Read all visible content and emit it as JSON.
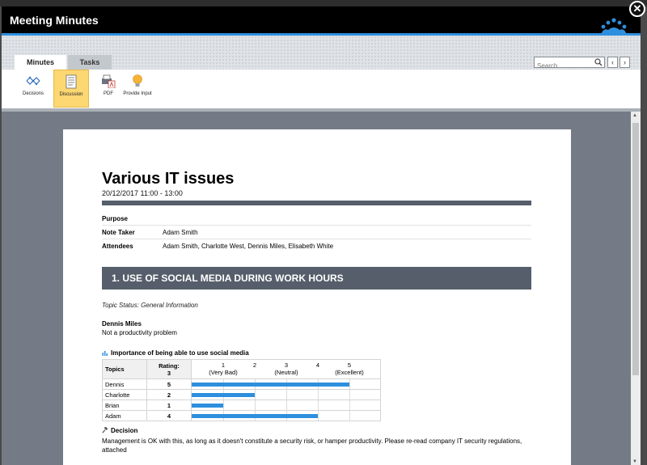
{
  "window": {
    "title": "Meeting Minutes"
  },
  "tabs": [
    {
      "label": "Minutes",
      "active": true
    },
    {
      "label": "Tasks",
      "active": false
    }
  ],
  "search": {
    "placeholder": "Search"
  },
  "nav": {
    "prev": "‹",
    "next": "›"
  },
  "ribbon": [
    {
      "label": "Decisions",
      "icon": "decisions-icon",
      "selected": false
    },
    {
      "label": "Discussion",
      "icon": "discussion-icon",
      "selected": true
    },
    {
      "label": "PDF",
      "icon": "pdf-icon",
      "selected": false
    },
    {
      "label": "Provide Input",
      "icon": "lightbulb-icon",
      "selected": false
    }
  ],
  "close": "✕",
  "doc": {
    "title": "Various IT issues",
    "date": "20/12/2017 11:00 - 13:00",
    "info": [
      {
        "key": "Purpose",
        "value": ""
      },
      {
        "key": "Note Taker",
        "value": "Adam Smith"
      },
      {
        "key": "Attendees",
        "value": "Adam Smith, Charlotte West, Dennis Miles, Elisabeth White"
      }
    ],
    "section": {
      "heading": "1. USE OF SOCIAL MEDIA DURING WORK HOURS",
      "status": "Topic Status:  General Information",
      "speaker": "Dennis Miles",
      "comment": "Not a productivity problem",
      "rating": {
        "title": "Importance of being able to use social media",
        "col_topics": "Topics",
        "col_rating": "Rating:",
        "col_rating_value": "3",
        "scale": [
          {
            "num": "1",
            "label": "(Very Bad)"
          },
          {
            "num": "2",
            "label": ""
          },
          {
            "num": "3",
            "label": "(Neutral)"
          },
          {
            "num": "4",
            "label": ""
          },
          {
            "num": "5",
            "label": "(Excellent)"
          }
        ],
        "rows": [
          {
            "name": "Dennis",
            "value": "5",
            "rating": 5
          },
          {
            "name": "Charlotte",
            "value": "2",
            "rating": 2
          },
          {
            "name": "Brian",
            "value": "1",
            "rating": 1
          },
          {
            "name": "Adam",
            "value": "4",
            "rating": 4
          }
        ]
      },
      "decision_heading": "Decision",
      "decision_text": "Management is OK with this, as long as it doesn't constitute a security risk, or hamper productivity. Please re-read company IT security regulations, attached"
    }
  },
  "colors": {
    "accent": "#2e8fde",
    "section": "#555e6a",
    "selected": "#fcd772",
    "content_bg": "#747b86"
  }
}
